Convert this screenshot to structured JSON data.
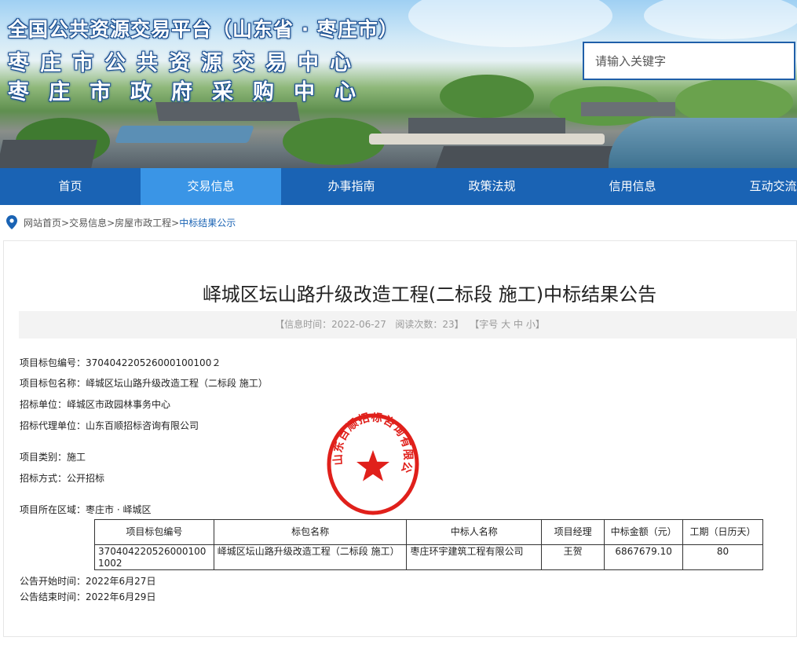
{
  "header": {
    "title_line1": "全国公共资源交易平台（山东省 · 枣庄市）",
    "title_line2": "枣庄市公共资源交易中心",
    "title_line3": "枣庄市政府采购中心",
    "search_placeholder": "请输入关键字"
  },
  "nav": {
    "items": [
      {
        "label": "首页"
      },
      {
        "label": "交易信息"
      },
      {
        "label": "办事指南"
      },
      {
        "label": "政策法规"
      },
      {
        "label": "信用信息"
      },
      {
        "label": "互动交流"
      }
    ],
    "active_index": 1
  },
  "breadcrumb": {
    "home": "网站首页>",
    "level1": "交易信息>",
    "level2": "房屋市政工程>",
    "current": "中标结果公示"
  },
  "article": {
    "title": "峄城区坛山路升级改造工程(二标段 施工)中标结果公告",
    "info": {
      "prefix": "【信息时间：",
      "date": "2022-06-27",
      "views_label": "阅读次数：",
      "views": "23",
      "suffix": "】",
      "font_label": "【字号",
      "font_large": "大",
      "font_medium": "中",
      "font_small": "小",
      "font_suffix": "】"
    },
    "fields": {
      "package_no": "项目标包编号：370404220526000100100２",
      "package_name": "项目标包名称：峄城区坛山路升级改造工程（二标段 施工）",
      "tenderer": "招标单位：峄城区市政园林事务中心",
      "agent": "招标代理单位：山东百顺招标咨询有限公司",
      "category": "项目类别：施工",
      "method": "招标方式：公开招标",
      "region": "项目所在区域：枣庄市 · 峄城区",
      "start_time": "公告开始时间：2022年6月27日",
      "end_time": "公告结束时间：2022年6月29日"
    },
    "stamp_text": "山东百顺招标咨询有限公司",
    "table": {
      "headers": {
        "package_no": "项目标包编号",
        "package_name": "标包名称",
        "winner": "中标人名称",
        "manager": "项目经理",
        "amount": "中标金额（元）",
        "duration": "工期（日历天）"
      },
      "rows": [
        {
          "package_no": "3704042205260001001002",
          "package_name": "峄城区坛山路升级改造工程（二标段 施工）",
          "winner": "枣庄环宇建筑工程有限公司",
          "manager": "王贺",
          "amount": "6867679.10",
          "duration": "80"
        }
      ]
    }
  },
  "colors": {
    "nav_bg": "#1a63b4",
    "nav_active": "#3a95e6",
    "stamp_red": "#e0201b",
    "title_stroke": "#1b4f91"
  }
}
